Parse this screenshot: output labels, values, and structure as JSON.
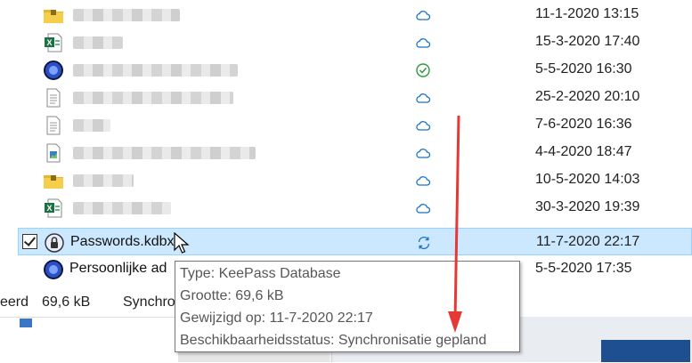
{
  "files": [
    {
      "icon": "folder-archive-icon",
      "blur": 120,
      "status": "cloud-icon",
      "date": "11-1-2020 13:15"
    },
    {
      "icon": "excel-file-icon",
      "blur": 56,
      "status": "cloud-icon",
      "date": "15-3-2020 17:40"
    },
    {
      "icon": "app-file-icon",
      "blur": 185,
      "status": "synced-check-icon",
      "date": "5-5-2020 16:30"
    },
    {
      "icon": "text-file-icon",
      "blur": 180,
      "status": "cloud-icon",
      "date": "25-2-2020 20:10"
    },
    {
      "icon": "text-file-icon",
      "blur": 42,
      "status": "cloud-icon",
      "date": "7-6-2020 16:36"
    },
    {
      "icon": "image-file-icon",
      "blur": 205,
      "status": "cloud-icon",
      "date": "4-4-2020 18:47"
    },
    {
      "icon": "folder-archive-icon",
      "blur": 68,
      "status": "cloud-icon",
      "date": "10-5-2020 14:03"
    },
    {
      "icon": "excel-file-icon",
      "blur": 110,
      "status": "cloud-icon",
      "date": "30-3-2020 19:39"
    }
  ],
  "selected_file": {
    "name": "Passwords.kdbx",
    "icon": "keepass-file-icon",
    "status": "sync-pending-icon",
    "date": "11-7-2020 22:17"
  },
  "last_file": {
    "name": "Persoonlijke ad",
    "icon": "app-file-icon",
    "date": "5-5-2020 17:35"
  },
  "statusbar": {
    "selected": "eerd",
    "size": "69,6 kB",
    "sync": "Synchro"
  },
  "tooltip": {
    "type": "Type: KeePass Database",
    "size": "Grootte: 69,6 kB",
    "modified": "Gewijzigd op: 11-7-2020 22:17",
    "availability": "Beschikbaarheidsstatus: Synchronisatie gepland"
  },
  "colors": {
    "selection": "#cce8ff",
    "cloud": "#1a73c8",
    "check": "#2e9a3d",
    "annotation_arrow": "#e53935"
  }
}
